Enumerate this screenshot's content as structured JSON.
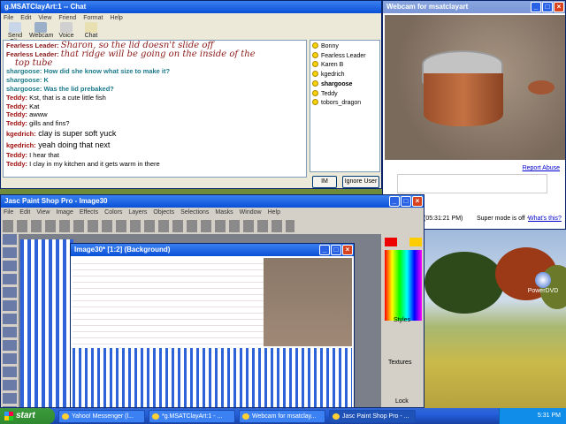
{
  "chat": {
    "title": "g.MSATClayArt:1 -- Chat",
    "menu": [
      "File",
      "Edit",
      "View",
      "Friend",
      "Format",
      "Help"
    ],
    "tools": [
      {
        "label": "Send File"
      },
      {
        "label": "Webcam"
      },
      {
        "label": "Voice"
      },
      {
        "label": "Chat"
      }
    ],
    "messages": [
      {
        "user": "Fearless Leader:",
        "text": "Sharon, so the lid doesn't slide off",
        "style": "script"
      },
      {
        "user": "Fearless Leader:",
        "text": "that ridge will be going on the inside of the",
        "style": "script"
      },
      {
        "user": "",
        "text": "top tube",
        "style": "script"
      },
      {
        "user": "shargoose:",
        "text": "How did she know what size to make it?",
        "style": "teal"
      },
      {
        "user": "shargoose:",
        "text": "K",
        "style": "teal"
      },
      {
        "user": "shargoose:",
        "text": "Was the lid prebaked?",
        "style": "teal"
      },
      {
        "user": "Teddy:",
        "text": "Kst, that is a cute little fish",
        "style": "plain"
      },
      {
        "user": "Teddy:",
        "text": "Kat",
        "style": "plain"
      },
      {
        "user": "Teddy:",
        "text": "awww",
        "style": "plain"
      },
      {
        "user": "Teddy:",
        "text": "gills and fins?",
        "style": "plain"
      },
      {
        "user": "kgedrich:",
        "text": "clay is super soft yuck",
        "style": "big"
      },
      {
        "user": "kgedrich:",
        "text": "yeah doing that next",
        "style": "big"
      },
      {
        "user": "Teddy:",
        "text": "I hear that",
        "style": "plain"
      },
      {
        "user": "Teddy:",
        "text": "I clay in my kitchen and it gets warm in there",
        "style": "plain"
      }
    ],
    "users": [
      "Bonny",
      "Fearless Leader",
      "Karen B",
      "kgedrich",
      "shargoose",
      "Teddy",
      "tobors_dragon"
    ],
    "im_label": "IM",
    "ignore_label": "Ignore User"
  },
  "webcam": {
    "title": "Webcam for msatclayart",
    "report_abuse": "Report Abuse",
    "timestamp": "(05:31:21 PM)",
    "super_mode": "Super mode is off -",
    "whats_this": "What's this?"
  },
  "psp": {
    "title": "Jasc Paint Shop Pro - Image30",
    "menu": [
      "File",
      "Edit",
      "View",
      "Image",
      "Effects",
      "Colors",
      "Layers",
      "Objects",
      "Selections",
      "Masks",
      "Window",
      "Help"
    ],
    "image_title": "Image30* [1:2] (Background)",
    "styles_label": "Styles",
    "textures_label": "Textures",
    "lock_label": "Lock"
  },
  "desktop": {
    "icon_label": "PowerDVD"
  },
  "taskbar": {
    "start": "start",
    "buttons": [
      "Yahoo! Messenger (l...",
      "*g.MSATClayArt:1 - ...",
      "Webcam for msatclay...",
      "Jasc Paint Shop Pro - ..."
    ],
    "clock": "5:31 PM"
  },
  "colors": {
    "title_blue": "#0a50d8",
    "teal": "#1a7a8a",
    "script_red": "#8b1a1a"
  }
}
